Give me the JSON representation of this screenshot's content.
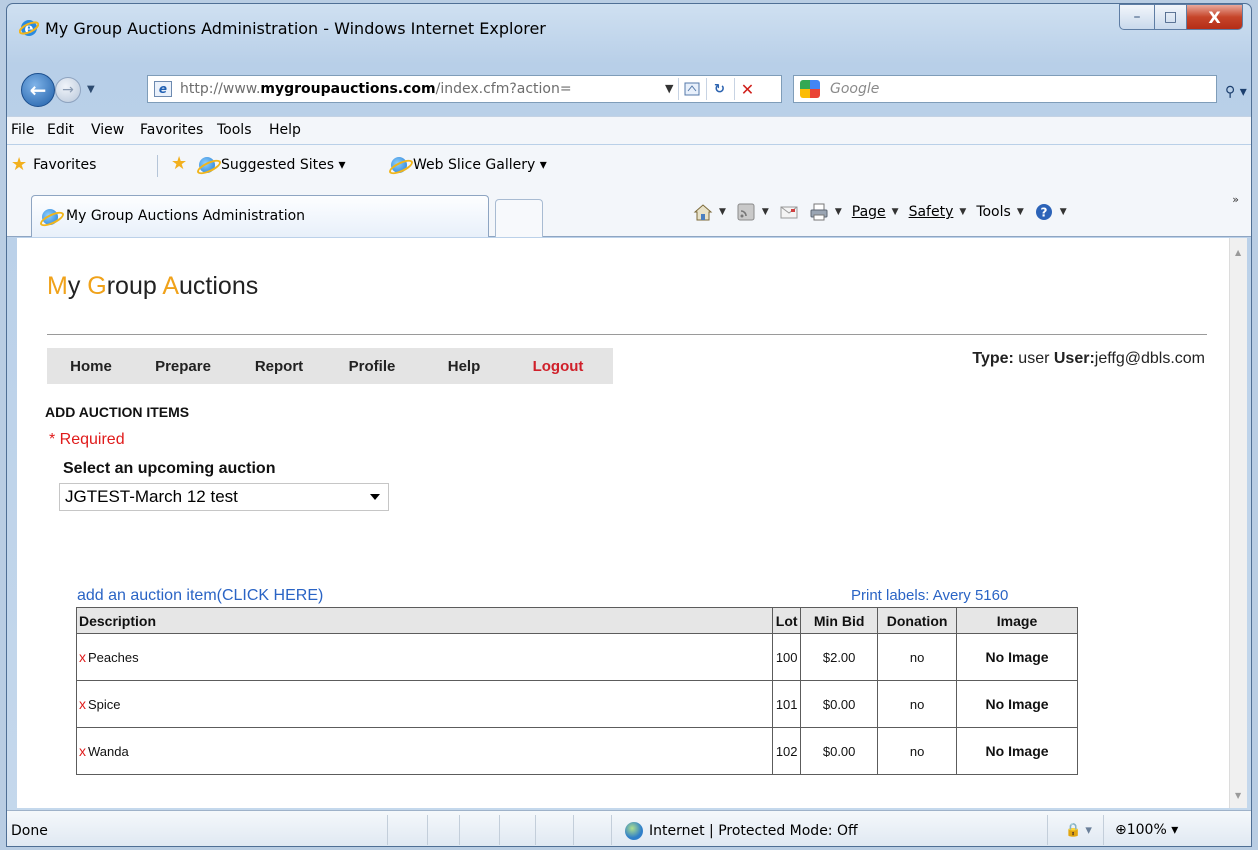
{
  "window": {
    "title": "My Group Auctions Administration - Windows Internet Explorer",
    "controls": {
      "minimize": "–",
      "maximize": "□",
      "close": "X"
    }
  },
  "navbar": {
    "url_prefix": "http://www.",
    "url_domain": "mygroupauctions.com",
    "url_suffix": "/index.cfm?action=",
    "search_placeholder": "Google",
    "back_glyph": "←"
  },
  "menu": {
    "items": [
      "File",
      "Edit",
      "View",
      "Favorites",
      "Tools",
      "Help"
    ]
  },
  "favorites_bar": {
    "favorites_label": "Favorites",
    "suggested_sites": "Suggested Sites ▾",
    "web_slice_gallery": "Web Slice Gallery ▾"
  },
  "tab": {
    "title": "My Group Auctions Administration"
  },
  "commandbar": {
    "page": "Page",
    "safety": "Safety",
    "tools": "Tools"
  },
  "site": {
    "title_parts": [
      "M",
      "y ",
      "G",
      "roup ",
      "A",
      "uctions"
    ],
    "accent_color": "#f0a21a"
  },
  "main_nav": {
    "items": [
      "Home",
      "Prepare",
      "Report",
      "Profile",
      "Help",
      "Logout"
    ]
  },
  "user": {
    "type_label": "Type:",
    "type_value": " user ",
    "user_label": "User:",
    "user_value": "jeffg@dbls.com"
  },
  "form": {
    "section_heading": "ADD AUCTION ITEMS",
    "required_note": "* Required",
    "select_label": "Select an upcoming auction",
    "selected_auction": "JGTEST-March 12 test"
  },
  "links": {
    "add_item": "add an auction item(CLICK HERE)",
    "print_labels": "Print labels: Avery 5160"
  },
  "table": {
    "headers": [
      "Description",
      "Lot",
      "Min Bid",
      "Donation",
      "Image"
    ],
    "delete_glyph": "x",
    "rows": [
      {
        "description": "Peaches",
        "lot": "100",
        "min_bid": "$2.00",
        "donation": "no",
        "image": "No Image"
      },
      {
        "description": "Spice",
        "lot": "101",
        "min_bid": "$0.00",
        "donation": "no",
        "image": "No Image"
      },
      {
        "description": "Wanda",
        "lot": "102",
        "min_bid": "$0.00",
        "donation": "no",
        "image": "No Image"
      }
    ]
  },
  "statusbar": {
    "status": "Done",
    "zone": "Internet | Protected Mode: Off",
    "zoom": "⊕100%  ▾"
  }
}
